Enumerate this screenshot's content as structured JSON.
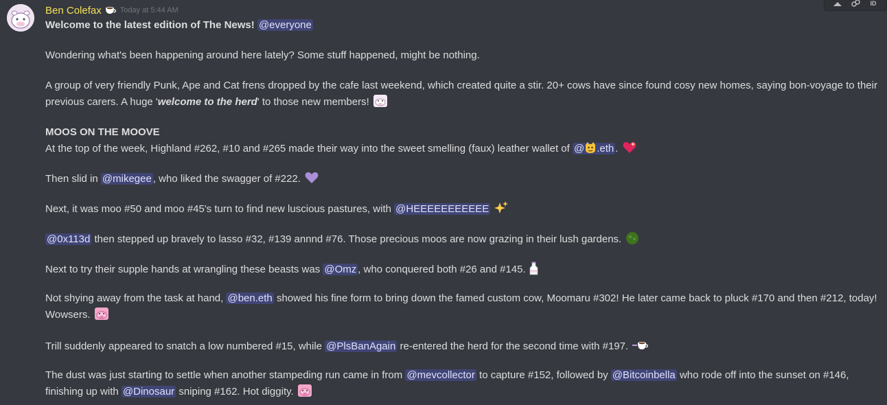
{
  "message": {
    "author": "Ben Colefax",
    "timestamp": "Today at 5:44 AM",
    "heading": "Welcome to the latest edition of The News!",
    "heading_mention": "@everyone",
    "p1": "Wondering what's been happening around here lately? Some stuff happened, might be nothing.",
    "p2_a": "A group of very friendly Punk, Ape and Cat frens dropped by the cafe last weekend, which created quite a stir. 20+ cows have since found cosy new homes, saying bon-voyage to their previous carers. A huge '",
    "p2_bi": "welcome to the herd",
    "p2_b": "' to those new members!",
    "section_title": "MOOS ON THE MOOVE",
    "p3_a": "At the top of the week, Highland #262, #10 and #265 made their way into the sweet smelling (faux) leather wallet of",
    "p3_mention_pre": "@",
    "p3_mention_post": ".eth",
    "p3_b": ".",
    "p4_a": "Then slid in",
    "p4_mention": "@mikegee",
    "p4_b": ", who liked the swagger of #222.",
    "p5_a": "Next, it was moo #50 and moo #45's turn to find new luscious pastures, with",
    "p5_mention": "@HEEEEEEEEEEE",
    "p6_mention": "@0x113d",
    "p6_b": "then stepped up bravely to lasso #32, #139 annnd #76. Those precious moos are now grazing in their lush gardens.",
    "p7_a": "Next to try their supple hands at wrangling these beasts was",
    "p7_mention": "@Omz",
    "p7_b": ", who conquered both #26 and #145.",
    "p8_a": "Not shying away from the task at hand,",
    "p8_mention": "@ben.eth",
    "p8_b": "showed his fine form to bring down the famed custom cow, Moomaru #302! He later came back to pluck #170 and then #212, today! Wowsers.",
    "p9_a": "Trill suddenly appeared to snatch a low numbered #15, while",
    "p9_mention": "@PlsBanAgain",
    "p9_b": "re-entered the herd for the second time with #197.",
    "p10_a": "The dust was just starting to settle when another stampeding run came in from",
    "p10_mention1": "@mevcollector",
    "p10_b": "to capture #152,  followed by",
    "p10_mention2": "@Bitcoinbella",
    "p10_c": "who rode off into the sunset on #146, finishing up with",
    "p10_mention3": "@Dinosaur",
    "p10_d": "sniping #162. Hot diggity."
  },
  "toolbar": {
    "icons": [
      "add-reaction-icon",
      "reply-icon",
      "more-icon"
    ],
    "id_label": "ID"
  },
  "colors": {
    "background": "#36393f",
    "author": "#f5e05a",
    "mention_bg": "#414675",
    "mention_text": "#dee0fc"
  }
}
